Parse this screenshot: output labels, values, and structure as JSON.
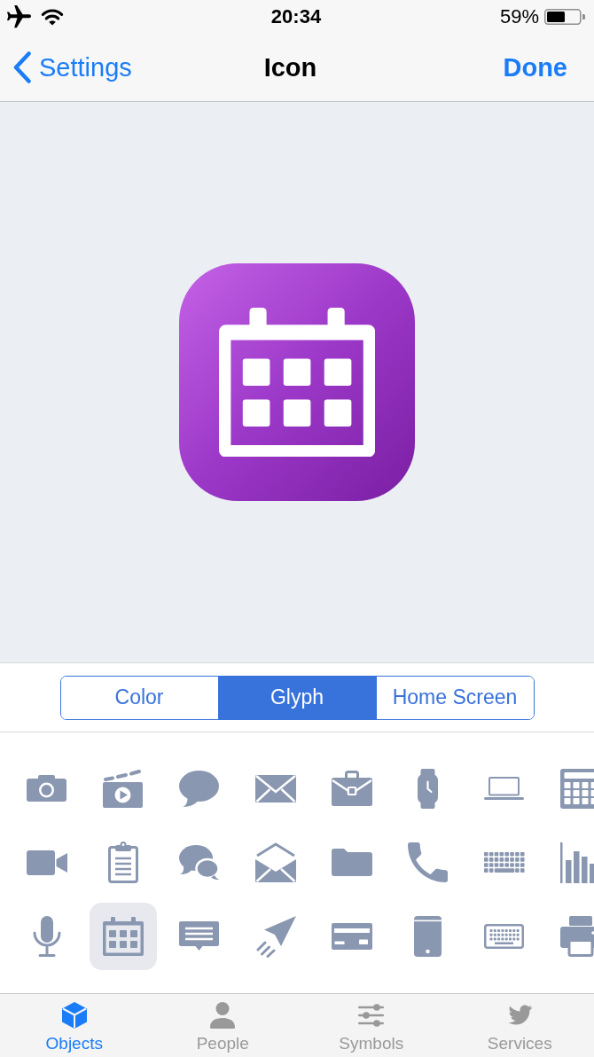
{
  "status_bar": {
    "time": "20:34",
    "battery": "59%"
  },
  "nav_bar": {
    "back": "Settings",
    "title": "Icon",
    "done": "Done"
  },
  "segments": [
    {
      "label": "Color",
      "selected": false
    },
    {
      "label": "Glyph",
      "selected": true
    },
    {
      "label": "Home Screen",
      "selected": false
    }
  ],
  "glyphs": [
    {
      "kind": "camera",
      "selected": false
    },
    {
      "kind": "clapper",
      "selected": false
    },
    {
      "kind": "bubble",
      "selected": false
    },
    {
      "kind": "envelope",
      "selected": false
    },
    {
      "kind": "briefcase",
      "selected": false
    },
    {
      "kind": "watch",
      "selected": false
    },
    {
      "kind": "laptop",
      "selected": false
    },
    {
      "kind": "calculator",
      "selected": false
    },
    {
      "kind": "video",
      "selected": false
    },
    {
      "kind": "clipboard",
      "selected": false
    },
    {
      "kind": "bubbles",
      "selected": false
    },
    {
      "kind": "openmail",
      "selected": false
    },
    {
      "kind": "folder",
      "selected": false
    },
    {
      "kind": "phone",
      "selected": false
    },
    {
      "kind": "keys",
      "selected": false
    },
    {
      "kind": "chart",
      "selected": false
    },
    {
      "kind": "mic",
      "selected": false
    },
    {
      "kind": "calendar",
      "selected": true
    },
    {
      "kind": "message",
      "selected": false
    },
    {
      "kind": "send",
      "selected": false
    },
    {
      "kind": "card",
      "selected": false
    },
    {
      "kind": "tablet",
      "selected": false
    },
    {
      "kind": "keyboard",
      "selected": false
    },
    {
      "kind": "printer",
      "selected": false
    }
  ],
  "tab_bar": [
    {
      "label": "Objects",
      "kind": "cube",
      "selected": true
    },
    {
      "label": "People",
      "kind": "person",
      "selected": false
    },
    {
      "label": "Symbols",
      "kind": "sliders",
      "selected": false
    },
    {
      "label": "Services",
      "kind": "bird",
      "selected": false
    }
  ]
}
